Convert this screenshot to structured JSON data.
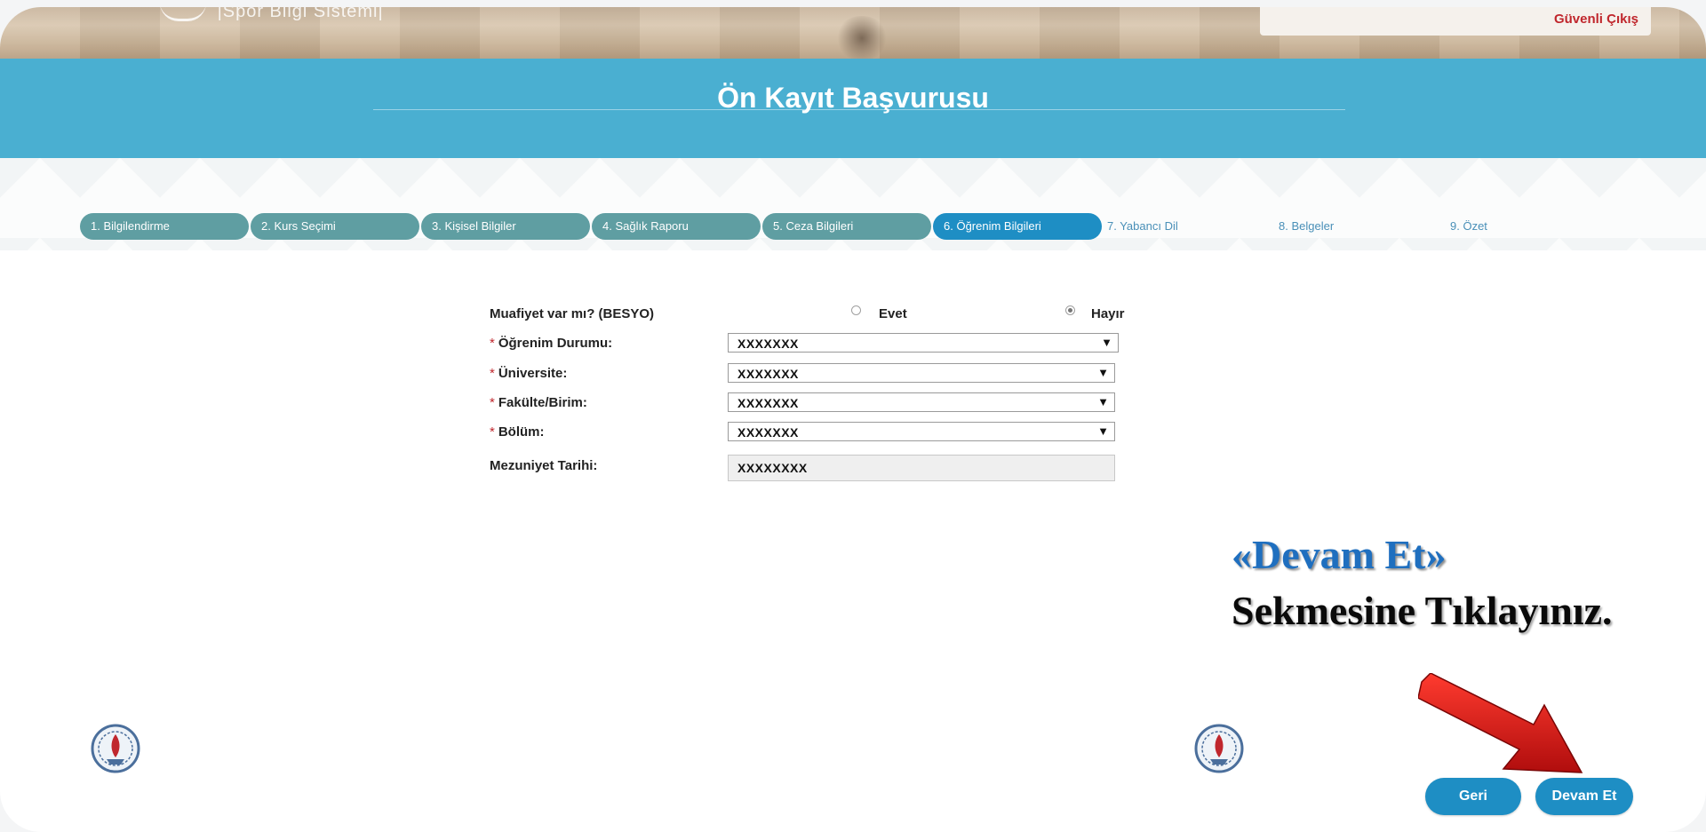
{
  "header": {
    "brand": "|Spor Bilgi Sistemi|",
    "logout_label": "Güvenli Çıkış"
  },
  "page": {
    "title": "Ön Kayıt Başvurusu"
  },
  "steps": [
    {
      "label": "1. Bilgilendirme",
      "state": "done"
    },
    {
      "label": "2. Kurs Seçimi",
      "state": "done"
    },
    {
      "label": "3. Kişisel Bilgiler",
      "state": "done"
    },
    {
      "label": "4. Sağlık Raporu",
      "state": "done"
    },
    {
      "label": "5. Ceza Bilgileri",
      "state": "done"
    },
    {
      "label": "6. Öğrenim Bilgileri",
      "state": "active"
    },
    {
      "label": "7. Yabancı Dil",
      "state": "future"
    },
    {
      "label": "8. Belgeler",
      "state": "future"
    },
    {
      "label": "9. Özet",
      "state": "future"
    }
  ],
  "form": {
    "exemption": {
      "label": "Muafiyet var mı? (BESYO)",
      "options": [
        "Evet",
        "Hayır"
      ],
      "selected": "Hayır"
    },
    "education_status": {
      "required_mark": "*",
      "label": "Öğrenim Durumu:",
      "value": "XXXXXXX"
    },
    "university": {
      "required_mark": "*",
      "label": "Üniversite:",
      "value": "XXXXXXX"
    },
    "faculty": {
      "required_mark": "*",
      "label": "Fakülte/Birim:",
      "value": "XXXXXXX"
    },
    "department": {
      "required_mark": "*",
      "label": "Bölüm:",
      "value": "XXXXXXX"
    },
    "graduation_date": {
      "label": "Mezuniyet Tarihi:",
      "value": "XXXXXXXX"
    },
    "dropdown_arrow": "▼"
  },
  "annotation": {
    "line1": "«Devam Et»",
    "line2": "Sekmesine Tıklayınız."
  },
  "buttons": {
    "back": "Geri",
    "continue": "Devam Et"
  },
  "colors": {
    "band": "#4aafd1",
    "step_done": "#5f9ea2",
    "step_active": "#1e8ec4",
    "button": "#1e8ec4",
    "logout": "#c0272d",
    "annotation_accent": "#1f6fbf"
  },
  "icons": [
    "laurel-logo-icon",
    "ministry-emblem-icon",
    "red-arrow-icon",
    "radio-icon",
    "dropdown-arrow-icon"
  ]
}
